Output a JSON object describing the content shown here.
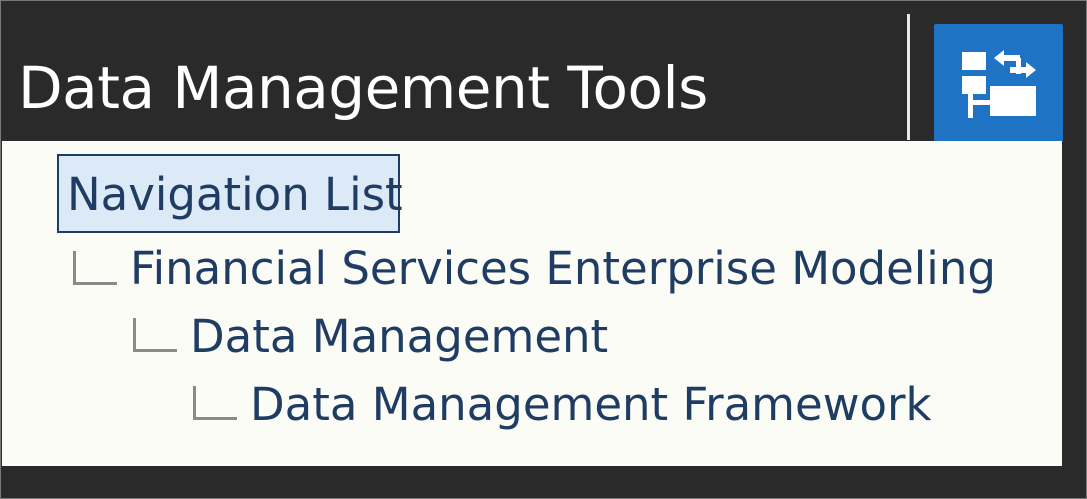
{
  "header": {
    "title": "Data Management Tools",
    "navigator_icon": "tree-swap-icon",
    "accent_color": "#1f73c4"
  },
  "navigation": {
    "title": "Navigation List",
    "items": [
      {
        "label": "Financial Services Enterprise Modeling",
        "level": 1
      },
      {
        "label": "Data Management",
        "level": 2
      },
      {
        "label": "Data Management Framework",
        "level": 3
      }
    ]
  },
  "colors": {
    "background": "#2a2a2a",
    "panel": "#fcfcf7",
    "link_text": "#1f3c63",
    "selection_fill": "#dce9f7"
  }
}
